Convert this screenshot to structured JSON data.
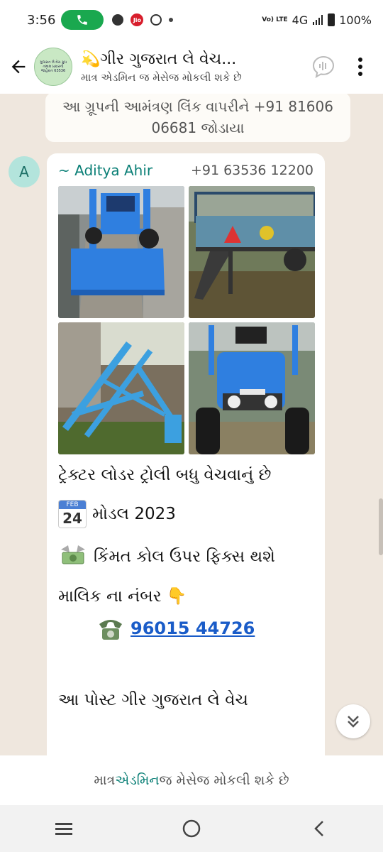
{
  "status_bar": {
    "time": "3:56",
    "jio": "Jio",
    "volte": "Vo) LTE",
    "network": "4G",
    "battery": "100%"
  },
  "header": {
    "title": "💫ગીર ગુજરાત લે વેચ...",
    "subtitle": "માત્ર એડમિન જ મેસેજ મોકલી શકે છે",
    "avatar_text": "ગુજરાત લે વેચ ગ્રુપ તમામ પ્રકારની જાહેરાત 63536"
  },
  "chat": {
    "system_message": "આ ગ્રૂપની આમંત્રણ લિંક વાપરીને +91 81606 06681 જોડાયા",
    "message": {
      "avatar_letter": "A",
      "sender_name": "~ Aditya Ahir",
      "sender_phone": "+91 63536 12200",
      "line1": "ટ્રેક્ટર લોડર ટ્રોલી બધુ વેચવાનું છે",
      "calendar_month": "FEB",
      "calendar_day": "24",
      "line2": "મોડલ 2023",
      "line3": "કિંમત કોલ ઉપર ફિક્સ થશે",
      "line4": "માલિક ના નંબર 👇",
      "owner_phone": "96015 44726",
      "line5": "આ પોસ્ટ ગીર ગુજરાત લે વેચ"
    }
  },
  "footer": {
    "prefix": "માત્ર ",
    "admin_word": "એડમિન",
    "suffix": " જ મેસેજ મોકલી શકે છે"
  },
  "colors": {
    "accent_green": "#0a7f76",
    "call_pill": "#1aa84f",
    "link_blue": "#1a5cc8",
    "tractor_blue": "#2f7fe0"
  }
}
